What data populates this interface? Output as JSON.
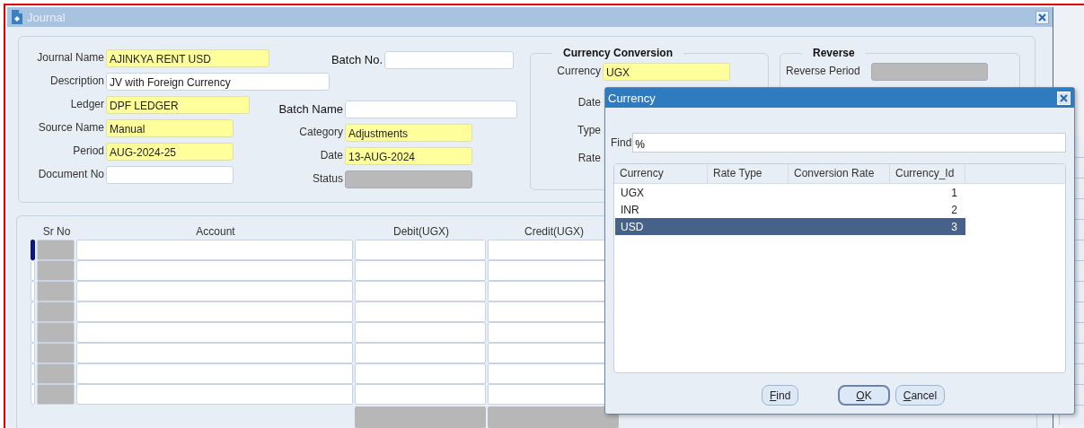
{
  "window": {
    "title": "Journal"
  },
  "header": {
    "left_fields": [
      {
        "label": "Journal Name",
        "value": "AJINKYA RENT USD",
        "kind": "required"
      },
      {
        "label": "Description",
        "value": "JV with Foreign Currency",
        "kind": "optional"
      },
      {
        "label": "Ledger",
        "value": "DPF LEDGER",
        "kind": "required"
      },
      {
        "label": "Source Name",
        "value": "Manual",
        "kind": "required"
      },
      {
        "label": "Period",
        "value": "AUG-2024-25",
        "kind": "required"
      },
      {
        "label": "Document No",
        "kind": "optional"
      }
    ],
    "right_fields": [
      {
        "label": "Batch No.",
        "kind": "optional"
      },
      {
        "label": "Batch Name",
        "kind": "optional"
      },
      {
        "label": "Category",
        "value": "Adjustments",
        "kind": "required"
      },
      {
        "label": "Date",
        "value": "13-AUG-2024",
        "kind": "required"
      },
      {
        "label": "Status",
        "kind": "readonly"
      }
    ]
  },
  "currency_conversion": {
    "title": "Currency Conversion",
    "fields": [
      {
        "label": "Currency",
        "value": "UGX",
        "kind": "required"
      },
      {
        "label": "Date"
      },
      {
        "label": "Type"
      },
      {
        "label": "Rate"
      }
    ]
  },
  "reverse": {
    "title": "Reverse",
    "fields": [
      {
        "label": "Reverse Period",
        "kind": "readonly"
      }
    ]
  },
  "lines": {
    "columns": [
      "Sr No",
      "Account",
      "Debit(UGX)",
      "Credit(UGX)"
    ],
    "rows": [
      {
        "selected": true
      },
      {
        "selected": false
      },
      {
        "selected": false
      },
      {
        "selected": false
      },
      {
        "selected": false
      },
      {
        "selected": false
      },
      {
        "selected": false
      },
      {
        "selected": false
      }
    ]
  },
  "dialog": {
    "title": "Currency",
    "find": {
      "label": "Find",
      "value": "%"
    },
    "columns": [
      "Currency",
      "Rate Type",
      "Conversion Rate",
      "Currency_Id"
    ],
    "rows": [
      {
        "currency": "UGX",
        "currency_id": "1",
        "selected": false
      },
      {
        "currency": "INR",
        "currency_id": "2",
        "selected": false
      },
      {
        "currency": "USD",
        "currency_id": "3",
        "selected": true
      }
    ],
    "buttons": [
      {
        "label": "Find",
        "default": false
      },
      {
        "label": "OK",
        "default": true
      },
      {
        "label": "Cancel",
        "default": false
      }
    ]
  }
}
